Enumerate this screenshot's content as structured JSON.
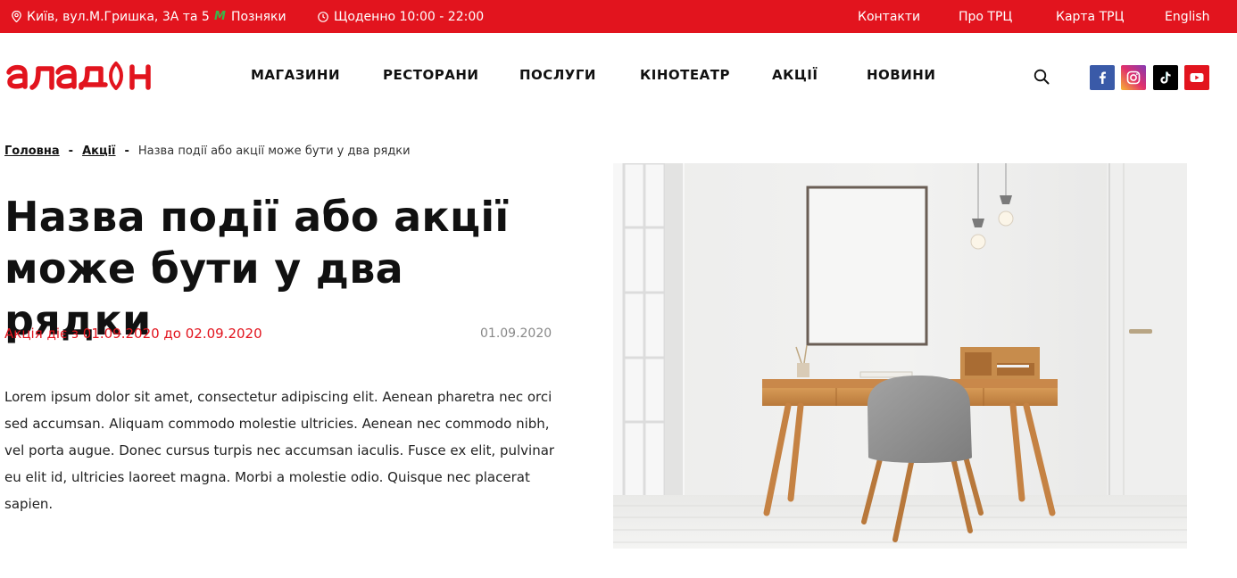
{
  "topbar": {
    "address": "Київ, вул.М.Гришка, 3А та 5",
    "metro": "Позняки",
    "hours": "Щоденно 10:00 - 22:00",
    "links": {
      "contacts": "Контакти",
      "about": "Про ТРЦ",
      "map": "Карта ТРЦ",
      "language": "English"
    },
    "background": "#e2141e"
  },
  "header": {
    "logo_text": "аладдін",
    "nav": {
      "shops": "МАГАЗИНИ",
      "restaurants": "РЕСТОРАНИ",
      "services": "ПОСЛУГИ",
      "cinema": "КІНОТЕАТР",
      "promotions": "АКЦІЇ",
      "news": "НОВИНИ"
    },
    "icons": {
      "search": "search-icon",
      "facebook": "facebook-icon",
      "instagram": "instagram-icon",
      "tiktok": "tiktok-icon",
      "youtube": "youtube-icon"
    }
  },
  "breadcrumb": {
    "home": "Головна",
    "separator": "-",
    "promotions": "Акції",
    "current": "Назва події або акції може бути у два рядки"
  },
  "article": {
    "title": "Назва події або акції може бути у два рядки",
    "period": "Акція діє з 01.09.2020 до 02.09.2020",
    "date": "01.09.2020",
    "body": "Lorem ipsum dolor sit amet, consectetur adipiscing elit. Aenean pharetra nec orci sed accumsan. Aliquam commodo molestie ultricies. Aenean nec commodo nibh, vel porta augue. Donec cursus turpis nec accumsan iaculis. Fusce ex elit, pulvinar eu elit id, ultricies laoreet magna. Morbi a molestie odio. Quisque nec placerat sapien."
  },
  "colors": {
    "accent": "#e2141e",
    "text": "#111111",
    "muted": "#888888"
  }
}
